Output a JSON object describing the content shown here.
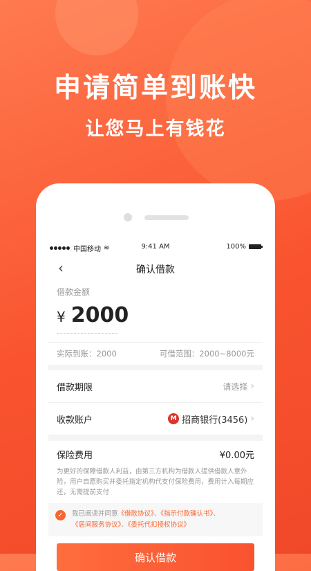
{
  "promo": {
    "headline": "申请简单到账快",
    "subline": "让您马上有钱花"
  },
  "status_bar": {
    "carrier": "中国移动",
    "time": "9:41 AM",
    "battery": "100%"
  },
  "nav": {
    "title": "确认借款"
  },
  "amount": {
    "label": "借款金额",
    "currency": "¥",
    "value": "2000"
  },
  "info": {
    "received": "实际到账：2000",
    "range": "可借范围：2000~8000元"
  },
  "rows": [
    {
      "label": "借款期限",
      "value": "请选择"
    },
    {
      "label": "收款账户",
      "value": "招商银行(3456)"
    }
  ],
  "insurance": {
    "label": "保险费用",
    "value": "¥0.00元",
    "description": "为更好的保障借款人利益，由第三方机构为借款人提供借款人意外险，用户自愿购买并委托指定机构代支付保险费用，费用计入每期应还，无需提前支付"
  },
  "agreement": {
    "prefix": "我已阅读并同意",
    "docs": [
      "《借款协议》",
      "《指示付款确认书》",
      "《居间服务协议》",
      "《委托代扣授权协议》"
    ],
    "separator": "、"
  },
  "submit_label": "确认借款",
  "colors": {
    "accent": "#f9652f",
    "bank": "#d9352b"
  }
}
